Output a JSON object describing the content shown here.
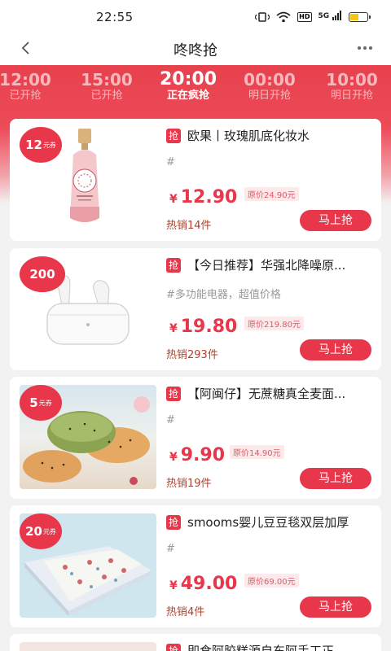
{
  "status_bar": {
    "time": "22:55",
    "hd": "HD",
    "signal": "5G"
  },
  "header": {
    "title": "咚咚抢"
  },
  "time_tabs": [
    {
      "time": "12:00",
      "status": "已开抢"
    },
    {
      "time": "15:00",
      "status": "已开抢"
    },
    {
      "time": "20:00",
      "status": "正在疯抢"
    },
    {
      "time": "00:00",
      "status": "明日开抢"
    },
    {
      "time": "10:00",
      "status": "明日开抢"
    }
  ],
  "qiang_label": "抢",
  "products": [
    {
      "coupon": "12",
      "coupon_unit": "元券",
      "title": "欧果丨玫瑰肌底化妆水",
      "desc": "#",
      "price_symbol": "¥",
      "price": "12.90",
      "original_price": "原价24.90元",
      "sold": "热销14件",
      "button": "马上抢"
    },
    {
      "coupon": "200",
      "coupon_unit": "",
      "title": "【今日推荐】华强北降噪原...",
      "desc": "#多功能电器，超值价格",
      "price_symbol": "¥",
      "price": "19.80",
      "original_price": "原价219.80元",
      "sold": "热销293件",
      "button": "马上抢"
    },
    {
      "coupon": "5",
      "coupon_unit": "元券",
      "title": "【阿闽仔】无蔗糖真全麦面...",
      "desc": "#",
      "price_symbol": "¥",
      "price": "9.90",
      "original_price": "原价14.90元",
      "sold": "热销19件",
      "button": "马上抢"
    },
    {
      "coupon": "20",
      "coupon_unit": "元券",
      "title": "smooms婴儿豆豆毯双层加厚",
      "desc": "#",
      "price_symbol": "¥",
      "price": "49.00",
      "original_price": "原价69.00元",
      "sold": "热销4件",
      "button": "马上抢"
    },
    {
      "coupon": "",
      "coupon_unit": "",
      "title": "即食阿胶糕源自东阿手工正",
      "desc": "",
      "price_symbol": "",
      "price": "",
      "original_price": "",
      "sold": "",
      "button": ""
    }
  ]
}
